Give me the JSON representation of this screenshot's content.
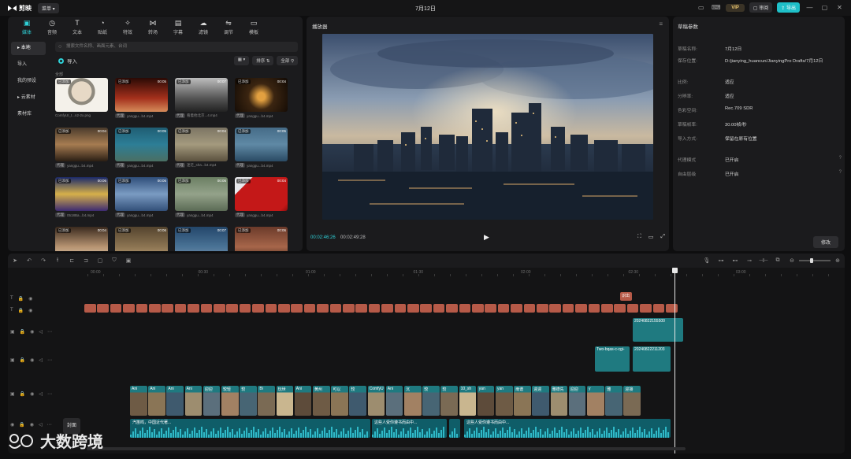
{
  "app": {
    "brand": "剪映",
    "menu_label": "菜单",
    "doc_title": "7月12日",
    "vip_label": "VIP",
    "share_label": "审阅",
    "export_label": "导出"
  },
  "media": {
    "tabs": [
      {
        "label": "媒体",
        "icon": "media-icon"
      },
      {
        "label": "音频",
        "icon": "audio-icon"
      },
      {
        "label": "文本",
        "icon": "text-icon"
      },
      {
        "label": "贴纸",
        "icon": "sticker-icon"
      },
      {
        "label": "特效",
        "icon": "effect-icon"
      },
      {
        "label": "转场",
        "icon": "transition-icon"
      },
      {
        "label": "字幕",
        "icon": "subtitle-icon"
      },
      {
        "label": "滤镜",
        "icon": "filter-icon"
      },
      {
        "label": "调节",
        "icon": "adjust-icon"
      },
      {
        "label": "模板",
        "icon": "template-icon"
      }
    ],
    "nav": [
      "本地",
      "导入",
      "我的预设",
      "云素材",
      "素材库"
    ],
    "search_placeholder": "搜索文件名称、画面元素、台词",
    "import_label": "导入",
    "sort_label": "排序",
    "all_label": "全部",
    "section_label": "全部",
    "items": [
      {
        "badge": "已添加",
        "duration": "",
        "name": "ComfyUI_t...n2-2x.png",
        "tag": ""
      },
      {
        "badge": "已添加",
        "duration": "00:05",
        "name": "yanggu...b4.mp4",
        "tag": "代理"
      },
      {
        "badge": "已添加",
        "duration": "00:07",
        "name": "看着他北京...4.mp4",
        "tag": "代理"
      },
      {
        "badge": "已添加",
        "duration": "00:04",
        "name": "yanggu...b4.mp4",
        "tag": "代理"
      },
      {
        "badge": "已添加",
        "duration": "00:04",
        "name": "yanggu...b4.mp4",
        "tag": "代理"
      },
      {
        "badge": "已添加",
        "duration": "00:05",
        "name": "yanggu...b4.mp4",
        "tag": "代理"
      },
      {
        "badge": "已添加",
        "duration": "00:04",
        "name": "迷茫_sha...b4.mp4",
        "tag": "代理"
      },
      {
        "badge": "已添加",
        "duration": "00:05",
        "name": "yanggu...b4.mp4",
        "tag": "代理"
      },
      {
        "badge": "已添加",
        "duration": "00:06",
        "name": "0518Ba...b4.mp4",
        "tag": "代理"
      },
      {
        "badge": "已添加",
        "duration": "00:06",
        "name": "yanggu...b4.mp4",
        "tag": "代理"
      },
      {
        "badge": "已添加",
        "duration": "00:06",
        "name": "yanggu...b4.mp4",
        "tag": "代理"
      },
      {
        "badge": "已添加",
        "duration": "00:04",
        "name": "yanggu...b4.mp4",
        "tag": "代理"
      },
      {
        "badge": "已添加",
        "duration": "00:04",
        "name": "",
        "tag": ""
      },
      {
        "badge": "已添加",
        "duration": "00:06",
        "name": "",
        "tag": ""
      },
      {
        "badge": "已添加",
        "duration": "00:07",
        "name": "",
        "tag": ""
      },
      {
        "badge": "已添加",
        "duration": "00:06",
        "name": "",
        "tag": ""
      }
    ]
  },
  "player": {
    "title": "播放器",
    "current_time": "00:02:46:26",
    "total_time": "00:02:49:28"
  },
  "props": {
    "title": "草稿参数",
    "rows": [
      {
        "k": "草稿名称:",
        "v": "7月12日"
      },
      {
        "k": "保存位置:",
        "v": "D:/jianying_huancun/JianyingPro Drafts/7月12日"
      },
      {
        "k": "比例:",
        "v": "适应"
      },
      {
        "k": "分辨率:",
        "v": "适应"
      },
      {
        "k": "色彩空间:",
        "v": "Rec.709 SDR"
      },
      {
        "k": "草稿帧率:",
        "v": "30.00帧/秒"
      },
      {
        "k": "导入方式:",
        "v": "保留在原有位置"
      },
      {
        "k": "代理模式",
        "v": "已开启"
      },
      {
        "k": "自由层级",
        "v": "已开启"
      }
    ],
    "modify_label": "修改"
  },
  "timeline": {
    "ruler": [
      "00:00",
      "00:30",
      "01:00",
      "01:30",
      "02:00",
      "02:30",
      "03:00"
    ],
    "cover_label": "封面",
    "tail_text_clip": "识出",
    "video_a_label": "20240822155500",
    "video_b1_label": "Two-bqas-c-cgi-",
    "video_b2_label": "20240822211203",
    "audio_clips": [
      "汽笛鸣，中国近代著...",
      "这些人受你遵书而由中...",
      "这些人受你遵书而由中..."
    ],
    "main_labels": [
      "Ani",
      "Ani",
      "Ani",
      "Ani",
      "迎迎",
      "较轻",
      "较",
      "Bi",
      "玩世",
      "Ani",
      "黄州",
      "可以",
      "较",
      "ComfyU",
      "Ani",
      "沉",
      "较",
      "较",
      "10_sh",
      "yan",
      "yan",
      "雨谱",
      "迎迎",
      "雅德先",
      "迎迎",
      "y",
      "雅",
      "迎接"
    ]
  },
  "watermark": "大数跨境"
}
